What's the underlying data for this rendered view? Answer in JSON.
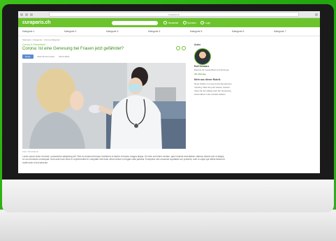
{
  "browser": {
    "url": "curaparis.ch"
  },
  "site": {
    "logo": "curaparis.ch"
  },
  "header_icons": [
    "Newsletter",
    "Spenden",
    "Login"
  ],
  "nav": [
    "Kategorie 1",
    "Kategorie 2",
    "Kategorie 3",
    "Kategorie 4",
    "Kategorie 5",
    "Kategorie 6",
    "Kategorie 7"
  ],
  "breadcrumb": "Startseite › Kategorie › Corona-Ratgeber",
  "article": {
    "category": "Corona & Gesundheit",
    "title": "Corona: Ist eine Genesung bei Frauen jetzt gefährdet?",
    "tag": "News",
    "author_meta": "Ruth Zimmermann",
    "date": "09.04.2021",
    "caption": "Foto: iStockphoto",
    "body": "Lorem ipsum dolor sit amet, consectetur adipiscing elit. Sed do eiusmod tempor incididunt ut labore et dolore magna aliqua. Ut enim ad minim veniam, quis nostrud exercitation ullamco laboris nisi ut aliquip ex ea commodo consequat. Duis aute irure dolor in reprehenderit in voluptate velit esse cillum dolore eu fugiat nulla pariatur. Excepteur sint occaecat cupidatat non proident, sunt in culpa qui officia deserunt mollit anim id est laborum."
  },
  "sidebar": {
    "author_title": "Autor",
    "author_name": "Rolf Schwarz",
    "author_role": "Experte für Gesundheit und Vorsorge",
    "author_link": "Alle Beiträge",
    "more_title": "Mehr aus dieser Rubrik",
    "more_items": [
      "Neue Studie zu Long-Covid-Symptomen",
      "Impfung: Was Sie jetzt wissen müssen",
      "Tipps für den Alltag nach der Genesung",
      "Gesundheit in der Familie stärken"
    ]
  },
  "colors": {
    "brand_green": "#6cc42c",
    "background_green": "#2fb315"
  }
}
